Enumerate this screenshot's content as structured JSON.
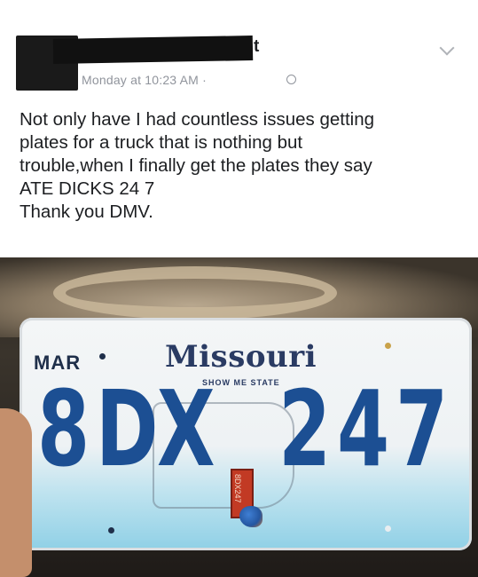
{
  "post": {
    "name_visible_fragment": "t",
    "timestamp": "Monday at 10:23 AM · ",
    "text_lines": [
      "Not only have I had countless issues getting",
      "plates for a truck that is nothing but",
      "trouble,when I finally get the plates they say",
      "ATE DICKS 24 7",
      "Thank you DMV."
    ]
  },
  "plate": {
    "month": "MAR",
    "state": "Missouri",
    "slogan": "SHOW ME STATE",
    "characters": [
      "8",
      "D",
      "X",
      "2",
      "4",
      "7"
    ],
    "sticker_text": "8DX247"
  },
  "colors": {
    "plate_text": "#1c4f93",
    "state_text": "#2a3b63",
    "sticker": "#c23a24",
    "post_text": "#1c1e21",
    "meta_text": "#90949c"
  },
  "icons": [
    "globe-icon",
    "chevron-down-icon",
    "bird-icon"
  ]
}
